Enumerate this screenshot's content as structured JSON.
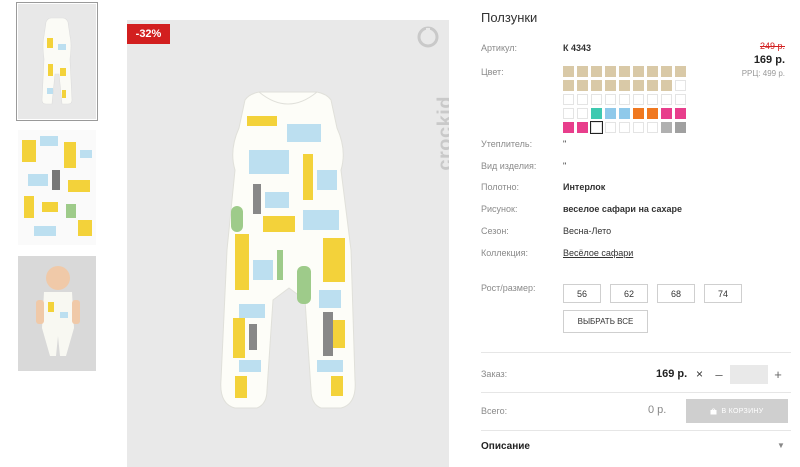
{
  "gallery": {
    "discount_badge": "-32%",
    "brand_text": "crockid",
    "thumbnails": [
      "thumb-front",
      "thumb-fabric",
      "thumb-model"
    ]
  },
  "product": {
    "title": "Ползунки",
    "article_label": "Артикул:",
    "article_value": "К 4343",
    "color_label": "Цвет:",
    "old_price": "249 р.",
    "price": "169 р.",
    "rrp": "РРЦ: 499 р.",
    "swatch_colors": [
      "#d9c9a7",
      "#d9c9a7",
      "#d9c9a7",
      "#d9c9a7",
      "#d9c9a7",
      "#d9c9a7",
      "#d9c9a7",
      "#d9c9a7",
      "#d9c9a7",
      "#d9c9a7",
      "#d9c9a7",
      "#d9c9a7",
      "#d9c9a7",
      "#d9c9a7",
      "#d9c9a7",
      "#d9c9a7",
      "#d9c9a7",
      "",
      "",
      "",
      "",
      "",
      "",
      "",
      "",
      "",
      "",
      "",
      "",
      "#3ec9b0",
      "#8fc9ea",
      "#8fc9ea",
      "#f07820",
      "#f07820",
      "#e83e8c",
      "#e83e8c",
      "#e83e8c",
      "#e83e8c",
      "sel",
      "",
      "",
      "",
      "",
      "#b0b0b0",
      "#a0a0a0"
    ],
    "attributes": [
      {
        "label": "Утеплитель:",
        "value": "\"",
        "bold": false
      },
      {
        "label": "Вид изделия:",
        "value": "\"",
        "bold": false
      },
      {
        "label": "Полотно:",
        "value": "Интерлок",
        "bold": true
      },
      {
        "label": "Рисунок:",
        "value": "веселое сафари на сахаре",
        "bold": true
      },
      {
        "label": "Сезон:",
        "value": "Весна-Лето",
        "bold": false
      }
    ],
    "collection_label": "Коллекция:",
    "collection_value": "Весёлое сафари",
    "size_label": "Рост/размер:",
    "sizes": [
      "56",
      "62",
      "68",
      "74"
    ],
    "select_all": "ВЫБРАТЬ ВСЕ",
    "order_label": "Заказ:",
    "order_price": "169 р.",
    "times": "×",
    "minus": "–",
    "plus": "+",
    "qty": "",
    "total_label": "Всего:",
    "total_value": "0 р.",
    "cart_button": "В КОРЗИНУ",
    "description_title": "Описание",
    "description_caret": "▼"
  },
  "colors": {
    "accent_red": "#d21f1f",
    "cart_disabled": "#cfcfcf"
  }
}
